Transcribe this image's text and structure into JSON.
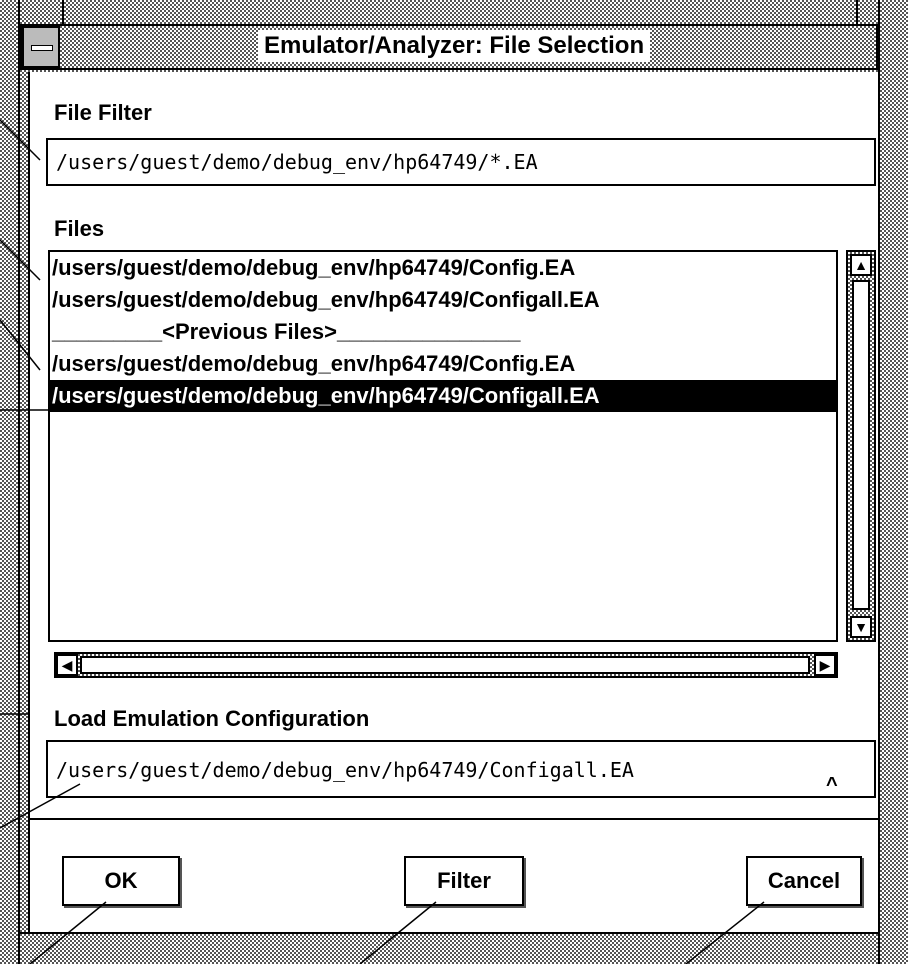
{
  "window": {
    "title": "Emulator/Analyzer: File Selection"
  },
  "file_filter": {
    "label": "File Filter",
    "value": "/users/guest/demo/debug_env/hp64749/*.EA"
  },
  "files": {
    "label": "Files",
    "items": [
      {
        "text": "/users/guest/demo/debug_env/hp64749/Config.EA",
        "selected": false
      },
      {
        "text": "/users/guest/demo/debug_env/hp64749/Configall.EA",
        "selected": false
      },
      {
        "text": "_________<Previous Files>_______________",
        "selected": false
      },
      {
        "text": "/users/guest/demo/debug_env/hp64749/Config.EA",
        "selected": false
      },
      {
        "text": "/users/guest/demo/debug_env/hp64749/Configall.EA",
        "selected": true
      }
    ]
  },
  "selection": {
    "label": "Load Emulation Configuration",
    "value": "/users/guest/demo/debug_env/hp64749/Configall.EA",
    "caret": "^"
  },
  "buttons": {
    "ok": "OK",
    "filter": "Filter",
    "cancel": "Cancel"
  },
  "icons": {
    "window_menu": "window-menu-icon",
    "scroll_up": "triangle-up-icon",
    "scroll_down": "triangle-down-icon",
    "scroll_left": "triangle-left-icon",
    "scroll_right": "triangle-right-icon"
  }
}
